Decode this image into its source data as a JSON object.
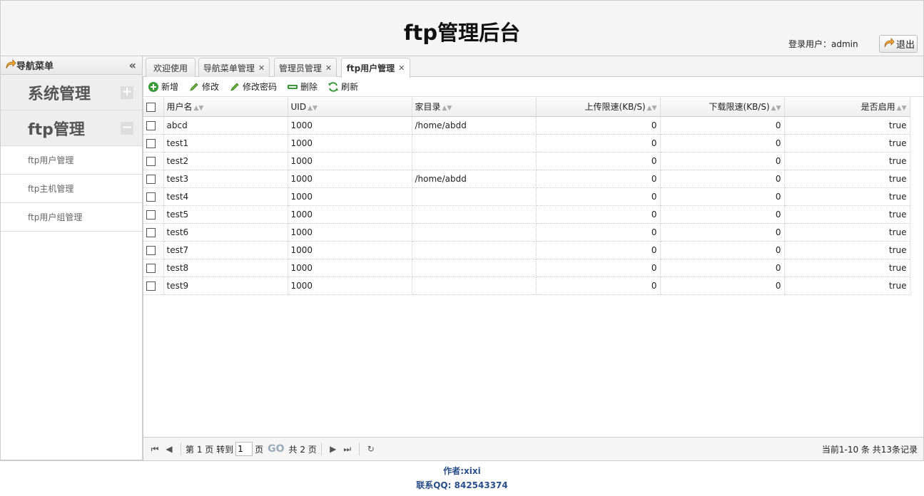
{
  "header": {
    "title": "ftp管理后台",
    "login_label": "登录用户：admin",
    "logout_label": "退出"
  },
  "sidebar": {
    "title": "导航菜单",
    "groups": [
      {
        "label": "系统管理",
        "toggle": "+"
      },
      {
        "label": "ftp管理",
        "toggle": "−"
      }
    ],
    "items": [
      {
        "label": "ftp用户管理"
      },
      {
        "label": "ftp主机管理"
      },
      {
        "label": "ftp用户组管理"
      }
    ]
  },
  "tabs": [
    {
      "label": "欢迎使用"
    },
    {
      "label": "导航菜单管理"
    },
    {
      "label": "管理员管理"
    },
    {
      "label": "ftp用户管理"
    }
  ],
  "toolbar": {
    "add": "新增",
    "edit": "修改",
    "edit_password": "修改密码",
    "delete": "删除",
    "refresh": "刷新"
  },
  "grid": {
    "columns": [
      "用户名",
      "UID",
      "家目录",
      "上传限速(KB/S)",
      "下载限速(KB/S)",
      "是否启用"
    ],
    "rows": [
      {
        "name": "abcd",
        "uid": "1000",
        "home": "/home/abdd",
        "up": "0",
        "down": "0",
        "enabled": "true"
      },
      {
        "name": "test1",
        "uid": "1000",
        "home": "",
        "up": "0",
        "down": "0",
        "enabled": "true"
      },
      {
        "name": "test2",
        "uid": "1000",
        "home": "",
        "up": "0",
        "down": "0",
        "enabled": "true"
      },
      {
        "name": "test3",
        "uid": "1000",
        "home": "/home/abdd",
        "up": "0",
        "down": "0",
        "enabled": "true"
      },
      {
        "name": "test4",
        "uid": "1000",
        "home": "",
        "up": "0",
        "down": "0",
        "enabled": "true"
      },
      {
        "name": "test5",
        "uid": "1000",
        "home": "",
        "up": "0",
        "down": "0",
        "enabled": "true"
      },
      {
        "name": "test6",
        "uid": "1000",
        "home": "",
        "up": "0",
        "down": "0",
        "enabled": "true"
      },
      {
        "name": "test7",
        "uid": "1000",
        "home": "",
        "up": "0",
        "down": "0",
        "enabled": "true"
      },
      {
        "name": "test8",
        "uid": "1000",
        "home": "",
        "up": "0",
        "down": "0",
        "enabled": "true"
      },
      {
        "name": "test9",
        "uid": "1000",
        "home": "",
        "up": "0",
        "down": "0",
        "enabled": "true"
      }
    ]
  },
  "pager": {
    "page_prefix": "第 1 页 转到",
    "page_input": "1",
    "page_unit": "页",
    "go": "GO",
    "total_pages": "共 2 页",
    "info": "当前1-10 条 共13条记录"
  },
  "footer": {
    "author": "作者:xixi",
    "qq": "联系QQ:  842543374"
  }
}
